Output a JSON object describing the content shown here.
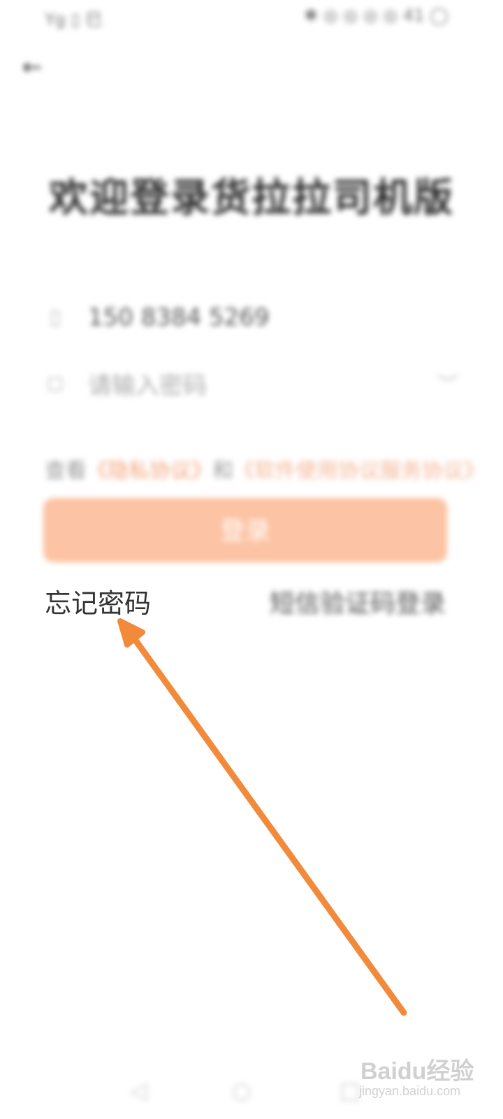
{
  "status_bar": {
    "left_text": "Yg ▯ 巳",
    "right_text": "✱ ◎ ◎ ◎ ◎ 41 ◯"
  },
  "header": {
    "back_icon": "back-arrow-icon",
    "title": "欢迎登录货拉拉司机版"
  },
  "form": {
    "phone_icon": "phone-icon",
    "phone_value": "150 8384 5269",
    "password_icon": "lock-icon",
    "password_placeholder": "请输入密码",
    "password_toggle_icon": "eye-closed-icon"
  },
  "agreement": {
    "prefix": "查看",
    "privacy_link": "《隐私协议》",
    "and": "和",
    "service_link": "《软件使用协议服务协议》"
  },
  "login_button": {
    "label": "登录",
    "color": "#fcc3a4"
  },
  "links": {
    "forgot_password": "忘记密码",
    "sms_login": "短信验证码登录"
  },
  "nav_bar": {
    "back_icon": "nav-back-icon",
    "home_icon": "nav-home-icon",
    "recent_icon": "nav-recent-icon"
  },
  "annotation": {
    "arrow_color": "#f28a3c"
  },
  "watermark": {
    "brand": "Baidu经验",
    "sub": "jingyan.baidu.com"
  }
}
